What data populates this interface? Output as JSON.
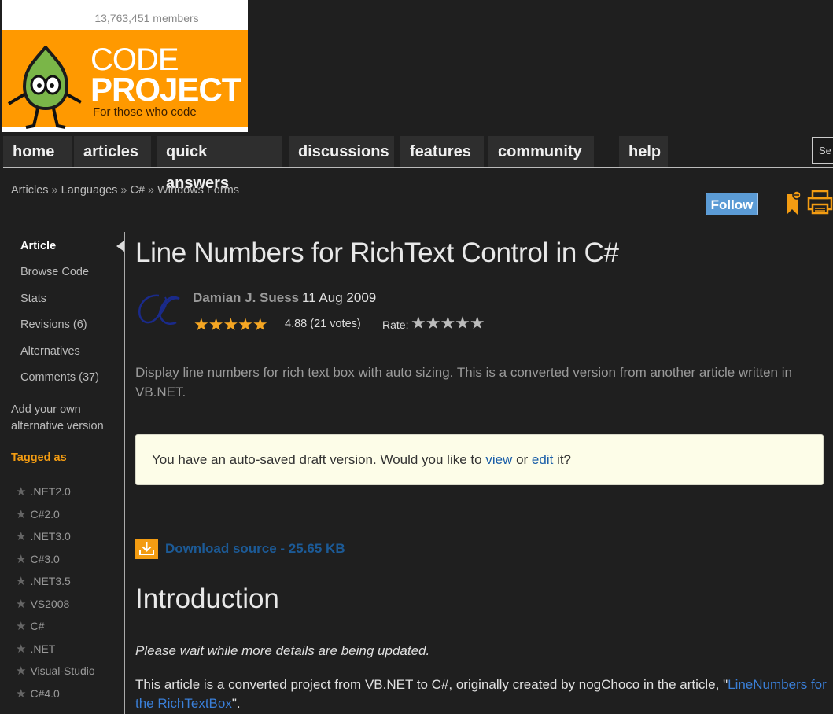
{
  "header": {
    "members": "13,763,451 members",
    "logo_code": "CODE",
    "logo_project": "PROJECT",
    "logo_tagline": "For those who code"
  },
  "nav": {
    "items": [
      "home",
      "articles",
      "quick answers",
      "discussions",
      "features",
      "community",
      "help"
    ],
    "search_placeholder": "Se"
  },
  "breadcrumb": {
    "items": [
      "Articles",
      "Languages",
      "C#",
      "Windows Forms"
    ],
    "separator": "»"
  },
  "actions": {
    "follow_label": "Follow"
  },
  "sidebar": {
    "links": [
      "Article",
      "Browse Code",
      "Stats",
      "Revisions (6)",
      "Alternatives",
      "Comments (37)"
    ],
    "add_own": "Add your own alternative version",
    "tagged_as": "Tagged as",
    "tags": [
      ".NET2.0",
      "C#2.0",
      ".NET3.0",
      "C#3.0",
      ".NET3.5",
      "VS2008",
      "C#",
      ".NET",
      "Visual-Studio",
      "C#4.0"
    ]
  },
  "article": {
    "title": "Line Numbers for RichText Control in C#",
    "author": "Damian J. Suess",
    "date": "11 Aug 2009",
    "rating_stars": "★★★★★",
    "rating_value": "4.88 (21 votes)",
    "rate_label": "Rate:",
    "rate_stars": "★★★★★",
    "summary": "Display line numbers for rich text box with auto sizing. This is a converted version from another article written in VB.NET.",
    "draft_text_before": "You have an auto-saved draft version. Would you like to ",
    "draft_view": "view",
    "draft_or": " or ",
    "draft_edit": "edit",
    "draft_after": " it?",
    "download_label": "Download source - 25.65 KB",
    "intro_heading": "Introduction",
    "wait_text": "Please wait while more details are being updated.",
    "body_before": "This article is a converted project from VB.NET to C#, originally created by nogChoco in the article, \"",
    "body_link": "LineNumbers for the RichTextBox",
    "body_after": "\"."
  },
  "colors": {
    "background": "#1f1f1f",
    "accent_orange": "#f39c12",
    "link_blue": "#1c5a96",
    "follow_blue": "#5b9bd5"
  }
}
